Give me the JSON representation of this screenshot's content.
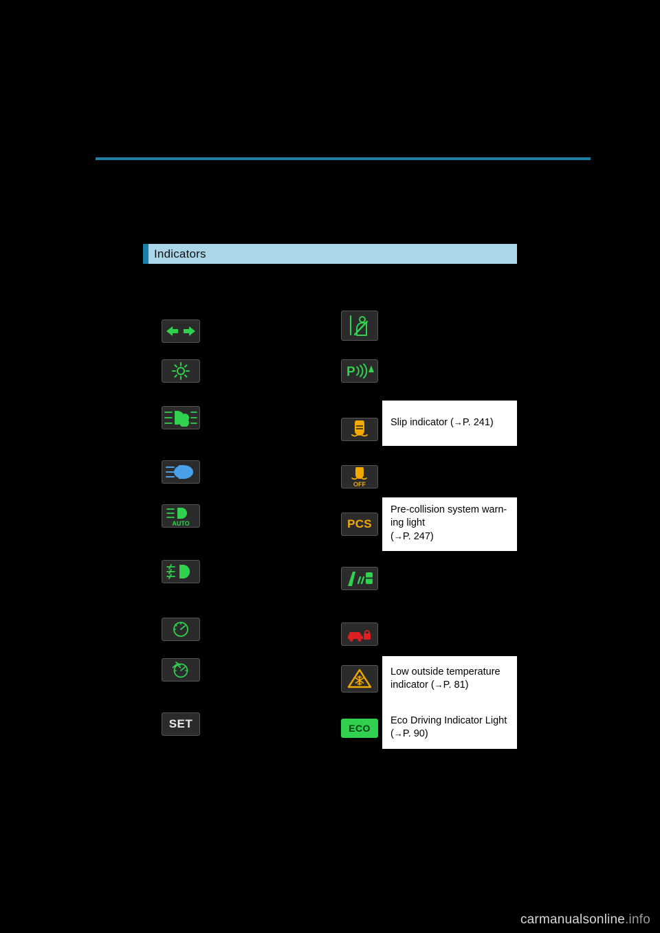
{
  "page": {
    "section_title": "Indicators"
  },
  "icons": {
    "turn_signal": "turn-signal-indicator",
    "tail_light": "tail-light-indicator",
    "low_beam": "headlight-low-beam-indicator",
    "high_beam": "headlight-high-beam-indicator",
    "auto_high_beam": "automatic-high-beam-indicator",
    "fog_light": "front-fog-light-indicator",
    "cruise_control": "cruise-control-indicator",
    "dynamic_radar_cruise": "dynamic-radar-cruise-control-indicator",
    "set_indicator": "set-indicator",
    "seat_belt_reminder": "seat-belt-reminder-indicator",
    "parking_assist": "parking-assist-indicator",
    "slip": "slip-indicator",
    "vsc_off": "vsc-off-indicator",
    "pcs": "pre-collision-system-warning-light",
    "lane_departure": "lane-departure-alert-indicator",
    "security": "security-indicator",
    "low_temperature": "low-outside-temperature-indicator",
    "eco": "eco-driving-indicator-light"
  },
  "labels": {
    "auto": "AUTO",
    "off": "OFF",
    "pcs": "PCS",
    "set": "SET",
    "eco": "ECO"
  },
  "callouts": {
    "slip": {
      "text": "Slip indicator (",
      "arrow": "→",
      "page": "P. 241)"
    },
    "pcs": {
      "line1": "Pre-collision  system  warn-",
      "line2": "ing light",
      "arrow": "→",
      "page": "P. 247)",
      "paren_open": "("
    },
    "low_temp": {
      "line1": "Low   outside   temperature",
      "line2": "indicator (",
      "arrow": "→",
      "page": "P. 81)"
    },
    "eco": {
      "line1": "Eco  Driving  Indicator  Light",
      "line2": "(",
      "arrow": "→",
      "page": "P. 90)"
    }
  },
  "footer": {
    "watermark_main": "carmanualsonline",
    "watermark_suffix": ".info"
  },
  "colors": {
    "accent": "#1c7fa8",
    "section_bg": "#a9d6e8",
    "green": "#2fd14f",
    "amber": "#f2a900",
    "blue": "#4aa0e8",
    "red": "#e02020",
    "tile_bg": "#2b2b2b"
  }
}
